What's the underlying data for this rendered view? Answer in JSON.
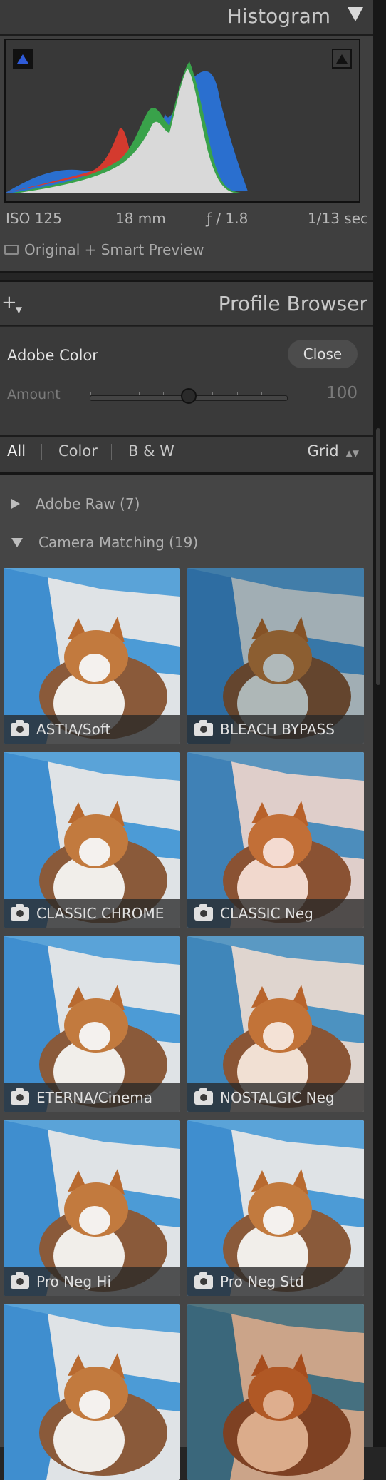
{
  "histogram": {
    "title": "Histogram",
    "iso": "ISO 125",
    "focal": "18 mm",
    "aperture": "ƒ / 1.8",
    "shutter": "1/13 sec",
    "preview_status": "Original + Smart Preview"
  },
  "profile_browser": {
    "title": "Profile Browser",
    "add_icon": "plus-icon",
    "current_profile": "Adobe Color",
    "close_label": "Close",
    "amount_label": "Amount",
    "amount_value": "100",
    "filters": [
      "All",
      "Color",
      "B & W"
    ],
    "active_filter": "All",
    "view_mode": "Grid",
    "groups": [
      {
        "label": "Adobe Raw (7)",
        "expanded": false
      },
      {
        "label": "Camera Matching (19)",
        "expanded": true
      }
    ],
    "profiles": [
      {
        "name": "ASTIA/Soft",
        "tint": "#ffffff"
      },
      {
        "name": "BLEACH BYPASS",
        "tint": "#b8c4c8"
      },
      {
        "name": "CLASSIC CHROME",
        "tint": "#ffffff"
      },
      {
        "name": "CLASSIC Neg",
        "tint": "#ffe8e0"
      },
      {
        "name": "ETERNA/Cinema",
        "tint": "#ffffff"
      },
      {
        "name": "NOSTALGIC Neg",
        "tint": "#fff0e6"
      },
      {
        "name": "Pro Neg Hi",
        "tint": "#ffffff"
      },
      {
        "name": "Pro Neg Std",
        "tint": "#ffffff"
      },
      {
        "name": "",
        "tint": "#ffffff"
      },
      {
        "name": "",
        "tint": "#e8b898"
      }
    ]
  }
}
